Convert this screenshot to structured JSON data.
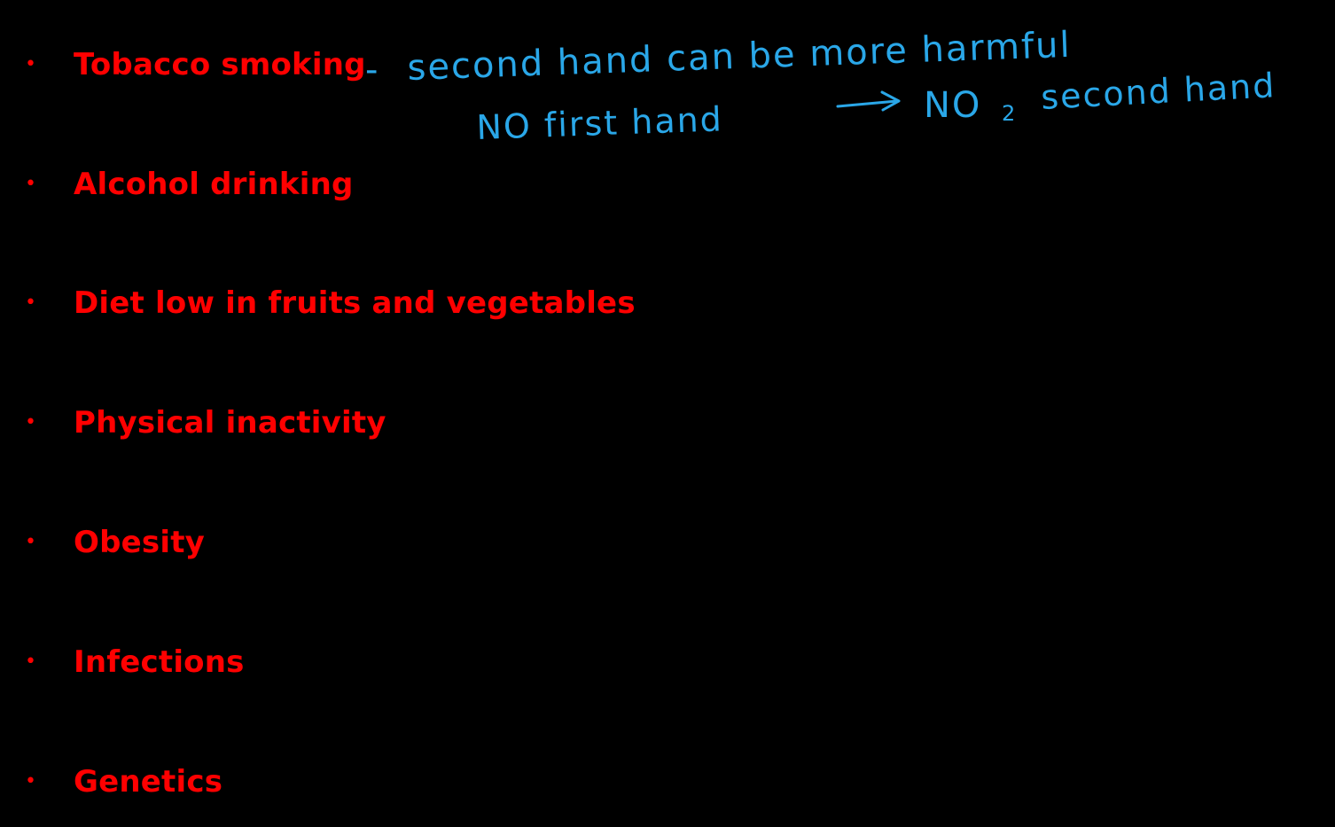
{
  "bullets": [
    "Tobacco smoking",
    "Alcohol drinking",
    "Diet low in fruits and vegetables",
    "Physical inactivity",
    "Obesity",
    "Infections",
    "Genetics"
  ],
  "annotations": {
    "line1_dash": "-",
    "line1_text": "second hand can be more harmful",
    "line2_text": "NO first hand",
    "line2_no": "NO",
    "line2_subscript": "2",
    "line2_tail": "second hand"
  },
  "colors": {
    "background": "#000000",
    "bullet_text": "#ff0000",
    "annotation": "#2aa7e8"
  }
}
